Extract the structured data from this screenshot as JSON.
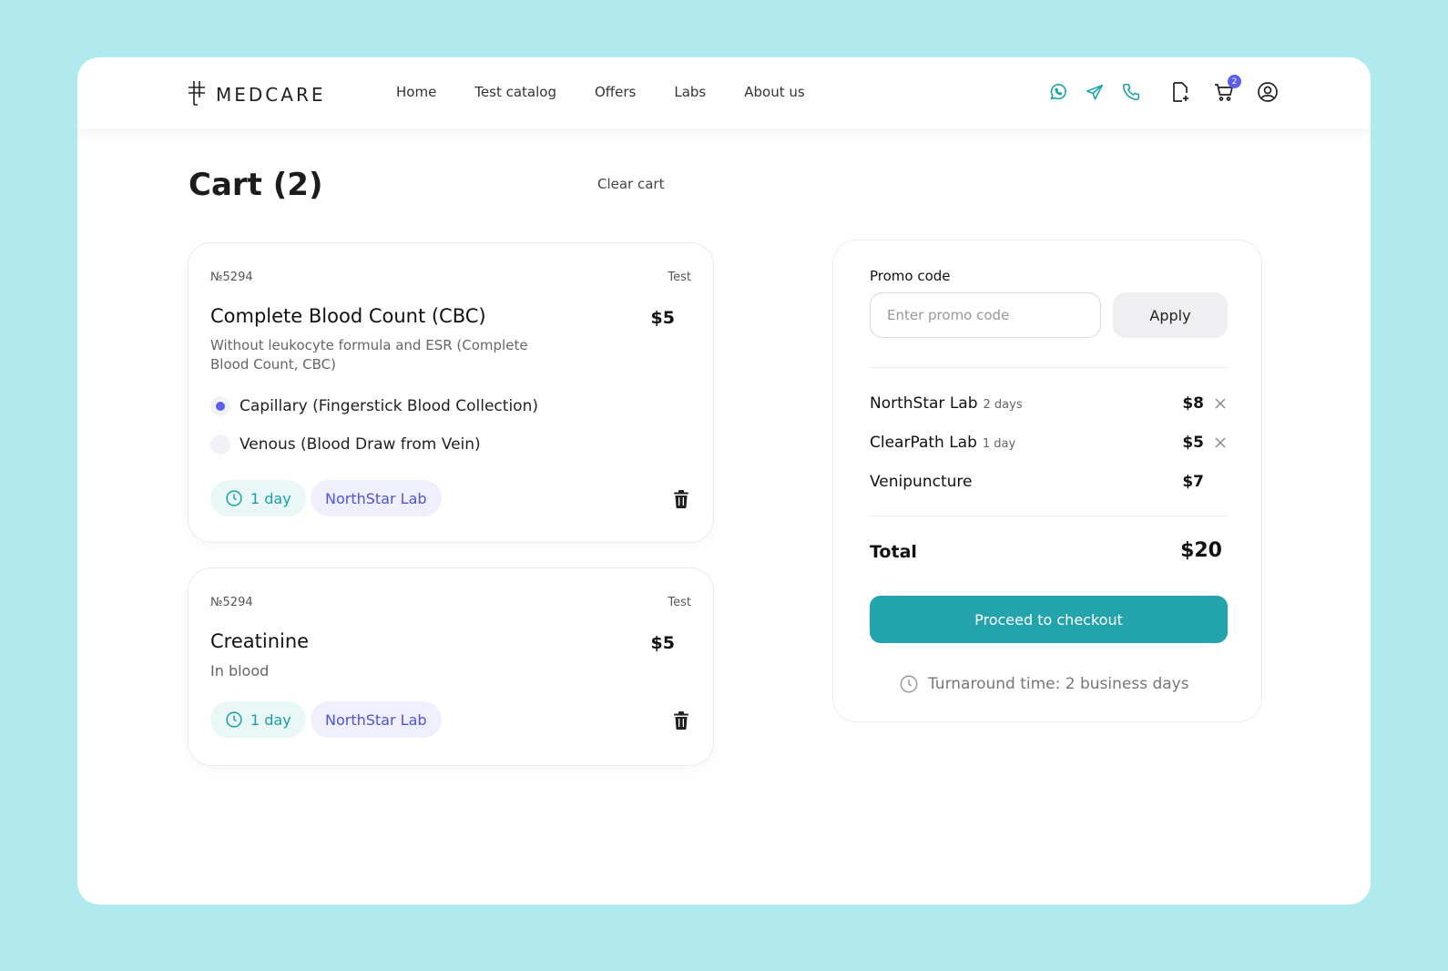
{
  "brand": {
    "name": "MEDCARE"
  },
  "nav": [
    "Home",
    "Test catalog",
    "Offers",
    "Labs",
    "About us"
  ],
  "header_icons": {
    "whatsapp": "whatsapp-icon",
    "telegram": "telegram-icon",
    "phone": "phone-icon",
    "document": "document-add-icon",
    "cart": "cart-icon",
    "cart_count": "2",
    "profile": "user-circle-icon"
  },
  "page": {
    "title": "Cart (2)",
    "clear_cart": "Clear cart"
  },
  "items": [
    {
      "number": "№5294",
      "type": "Test",
      "title": "Complete Blood Count (CBC)",
      "price": "$5",
      "subtitle": "Without leukocyte formula and ESR (Complete Blood Count, CBC)",
      "options": [
        {
          "label": "Capillary (Fingerstick Blood Collection)",
          "selected": true
        },
        {
          "label": "Venous (Blood Draw from Vein)",
          "selected": false
        }
      ],
      "duration": "1 day",
      "lab": "NorthStar Lab"
    },
    {
      "number": "№5294",
      "type": "Test",
      "title": "Creatinine",
      "price": "$5",
      "subtitle": "In blood",
      "duration": "1 day",
      "lab": "NorthStar Lab"
    }
  ],
  "summary": {
    "promo_label": "Promo code",
    "promo_placeholder": "Enter promo code",
    "apply": "Apply",
    "lines": [
      {
        "name": "NorthStar Lab",
        "days": "2 days",
        "price": "$8",
        "removable": true
      },
      {
        "name": "ClearPath Lab",
        "days": "1 day",
        "price": "$5",
        "removable": true
      },
      {
        "name": "Venipuncture",
        "days": "",
        "price": "$7",
        "removable": false
      }
    ],
    "total_label": "Total",
    "total_value": "$20",
    "checkout": "Proceed to checkout",
    "turnaround": "Turnaround time: 2 business days"
  },
  "colors": {
    "background": "#b0eaee",
    "accent": "#23a3ab",
    "lab_chip": "#4f53d8",
    "badge": "#5b5ef0"
  }
}
